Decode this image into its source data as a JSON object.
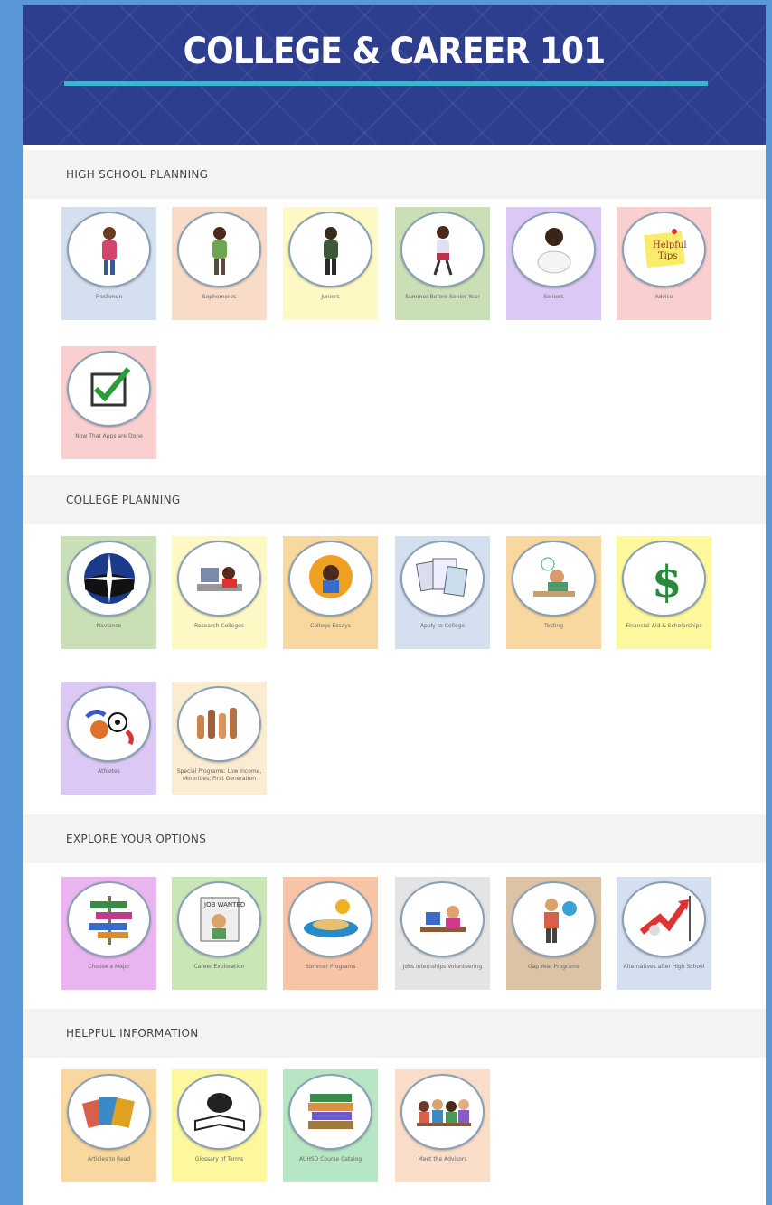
{
  "banner": {
    "title": "COLLEGE & CAREER 101"
  },
  "sections": [
    {
      "title": "HIGH SCHOOL PLANNING",
      "tiles": [
        {
          "label": "Freshmen",
          "icon": "student-girl-icon",
          "color": "#d4dff0"
        },
        {
          "label": "Sophomores",
          "icon": "student-boy-icon",
          "color": "#f9dcc8"
        },
        {
          "label": "Juniors",
          "icon": "student-icon",
          "color": "#fdf8c4"
        },
        {
          "label": "Summer Before Senior Year",
          "icon": "student-walking-icon",
          "color": "#c9dfb6"
        },
        {
          "label": "Seniors",
          "icon": "student-thinking-icon",
          "color": "#dcc8f5"
        },
        {
          "label": "Advice",
          "icon": "helpful-tips-note-icon",
          "color": "#f9cfcf"
        },
        {
          "label": "Now That Apps are Done",
          "icon": "checkbox-checked-icon",
          "color": "#f9cfcf"
        }
      ]
    },
    {
      "title": "COLLEGE PLANNING",
      "tiles": [
        {
          "label": "Naviance",
          "icon": "compass-star-icon",
          "color": "#c9dfb6"
        },
        {
          "label": "Research Colleges",
          "icon": "student-laptop-icon",
          "color": "#fdf8c4"
        },
        {
          "label": "College Essays",
          "icon": "student-writing-icon",
          "color": "#f8d89e"
        },
        {
          "label": "Apply to College",
          "icon": "paperwork-icon",
          "color": "#d4dff0"
        },
        {
          "label": "Testing",
          "icon": "student-test-icon",
          "color": "#f8d89e"
        },
        {
          "label": "Financial Aid & Scholarships",
          "icon": "dollar-sign-icon",
          "color": "#fdf89e"
        },
        {
          "label": "Athletes",
          "icon": "sports-balls-icon",
          "color": "#dcc8f5"
        },
        {
          "label": "Special Programs: Low Income, Minorities, First Generation",
          "icon": "raised-hands-icon",
          "color": "#faecd0"
        }
      ]
    },
    {
      "title": "EXPLORE YOUR OPTIONS",
      "tiles": [
        {
          "label": "Choose a Major",
          "icon": "signpost-icon",
          "color": "#eab4f0"
        },
        {
          "label": "Career Exploration",
          "icon": "job-search-icon",
          "color": "#c9e6b6"
        },
        {
          "label": "Summer Programs",
          "icon": "summer-beach-icon",
          "color": "#f8c4a6"
        },
        {
          "label": "Jobs Internships Volunteering",
          "icon": "desk-worker-icon",
          "color": "#e4e4e4"
        },
        {
          "label": "Gap Year Programs",
          "icon": "traveler-icon",
          "color": "#dcc3a6"
        },
        {
          "label": "Alternatives after High School",
          "icon": "red-arrow-figure-icon",
          "color": "#d4dff0"
        }
      ]
    },
    {
      "title": "HELPFUL INFORMATION",
      "tiles": [
        {
          "label": "Articles to Read",
          "icon": "magazines-icon",
          "color": "#f8d89e"
        },
        {
          "label": "Glossary of Terms",
          "icon": "reading-book-icon",
          "color": "#fdf89e"
        },
        {
          "label": "AUHSD Course Catalog",
          "icon": "book-stack-icon",
          "color": "#b6e6c4"
        },
        {
          "label": "Meet the Advisors",
          "icon": "advisors-group-icon",
          "color": "#faddc8"
        }
      ]
    }
  ]
}
